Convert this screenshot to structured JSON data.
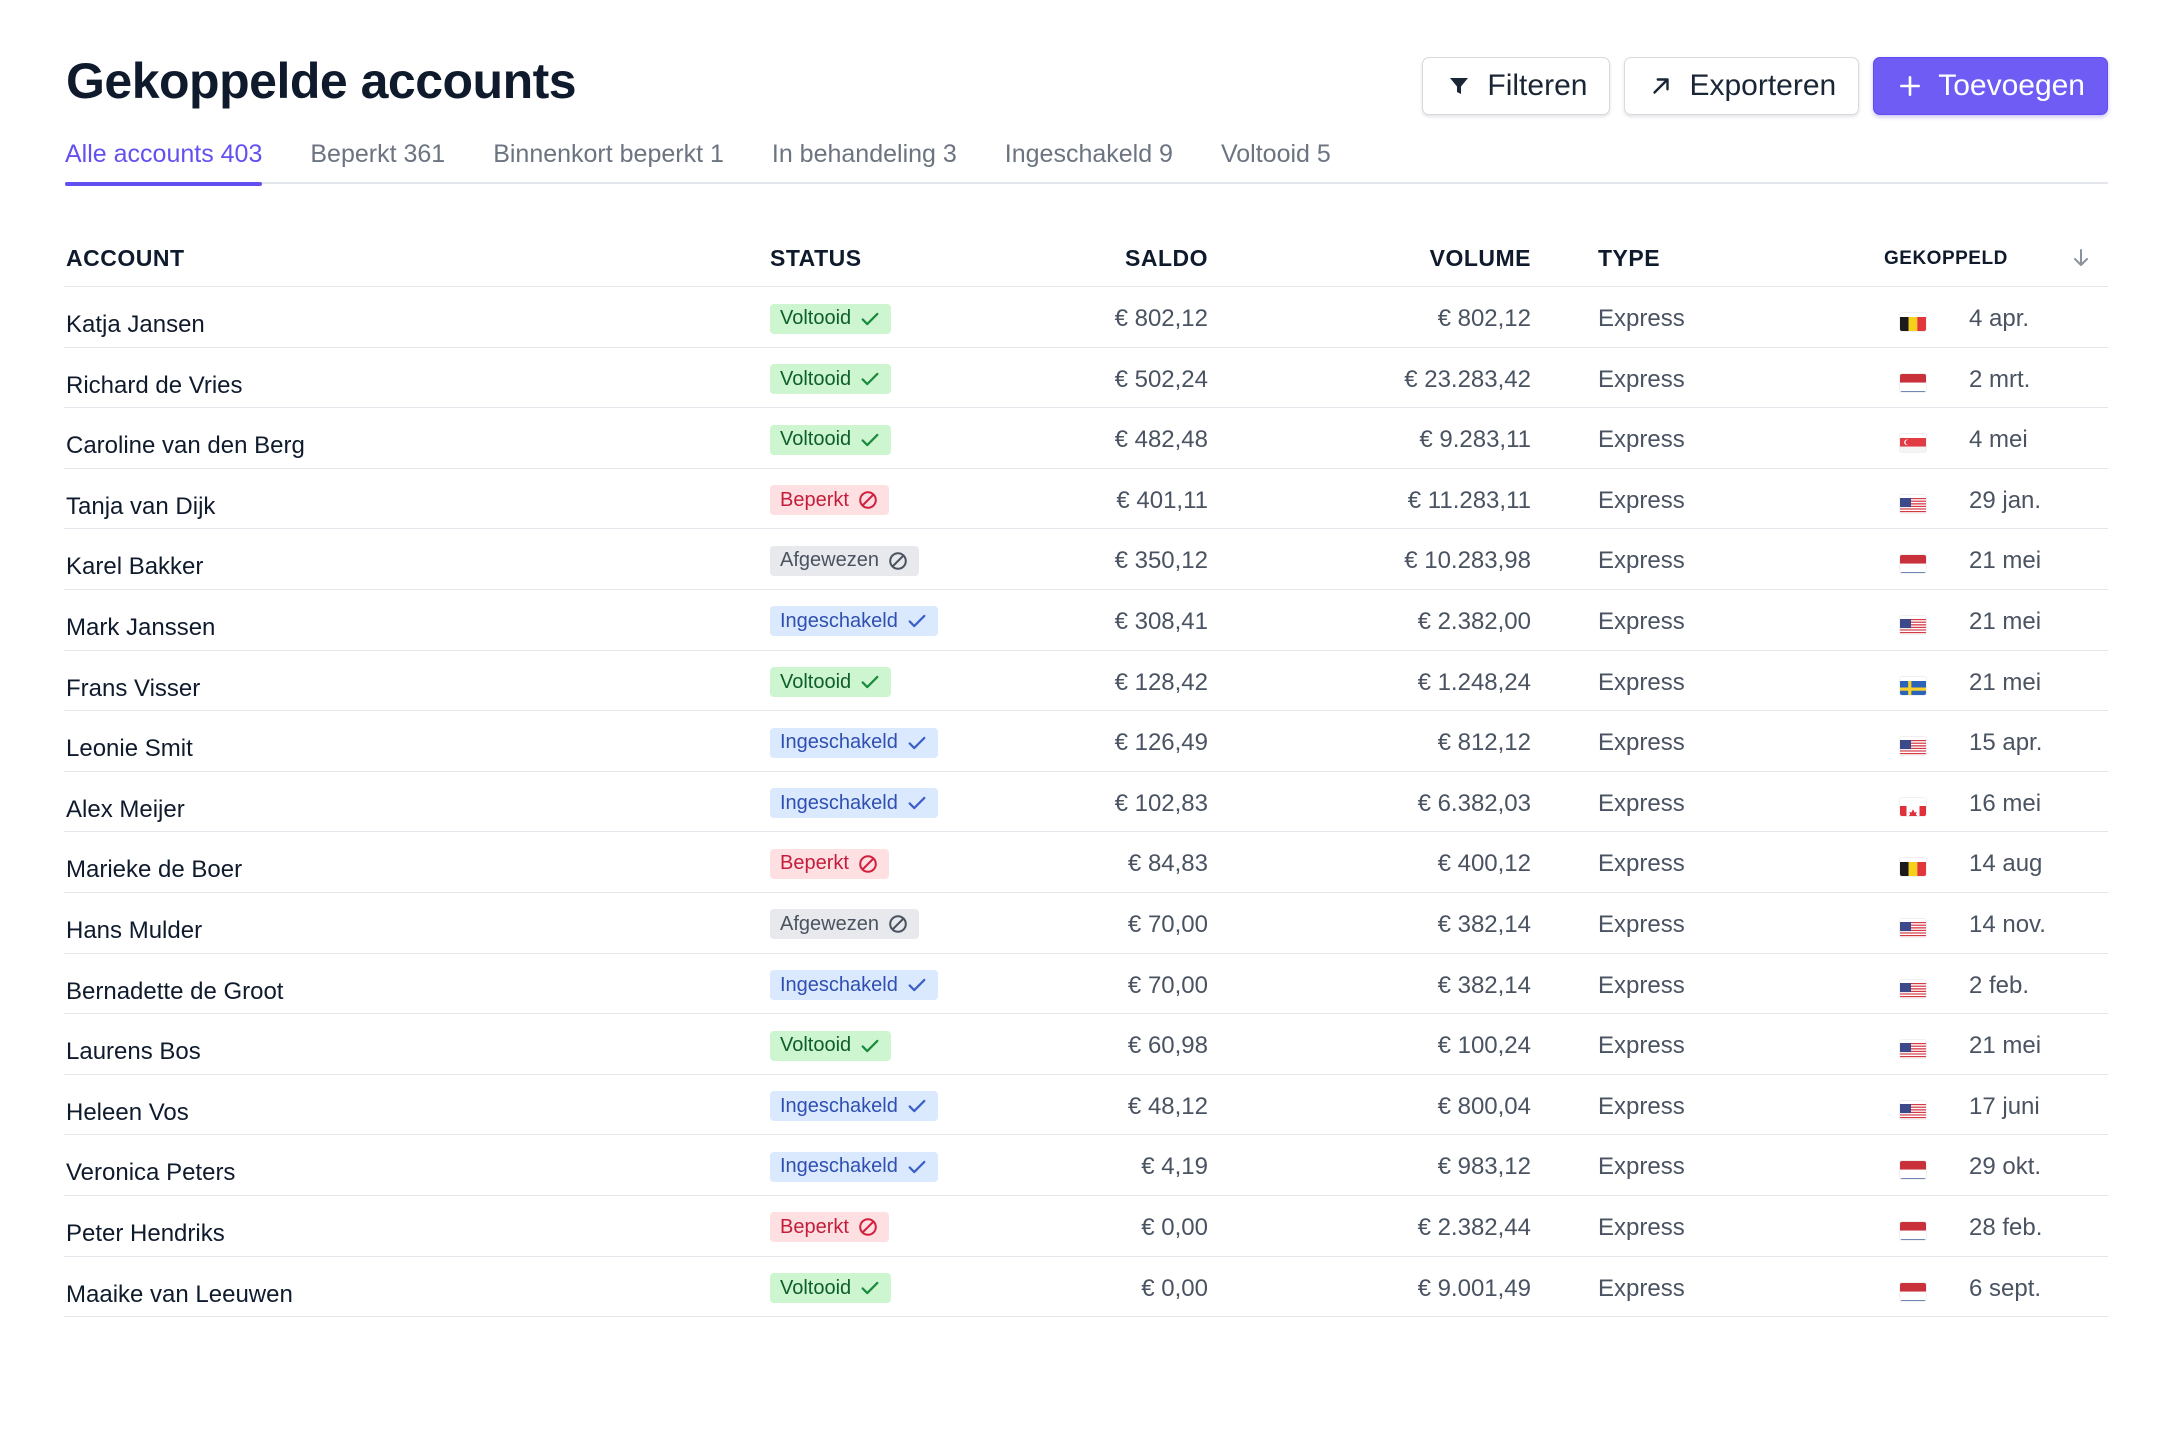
{
  "page": {
    "title": "Gekoppelde accounts"
  },
  "toolbar": {
    "filter_label": "Filteren",
    "export_label": "Exporteren",
    "add_label": "Toevoegen"
  },
  "tabs": [
    {
      "label": "Alle accounts 403",
      "active": true
    },
    {
      "label": "Beperkt 361",
      "active": false
    },
    {
      "label": "Binnenkort beperkt 1",
      "active": false
    },
    {
      "label": "In behandeling 3",
      "active": false
    },
    {
      "label": "Ingeschakeld 9",
      "active": false
    },
    {
      "label": "Voltooid 5",
      "active": false
    }
  ],
  "table": {
    "headers": {
      "account": "ACCOUNT",
      "status": "STATUS",
      "saldo": "SALDO",
      "volume": "VOLUME",
      "type": "TYPE",
      "gekoppeld": "GEKOPPELD"
    },
    "rows": [
      {
        "name": "Katja Jansen",
        "status": "Voltooid",
        "status_kind": "voltooid",
        "saldo": "€ 802,12",
        "volume": "€ 802,12",
        "type": "Express",
        "flag": "BE",
        "date": "4 apr."
      },
      {
        "name": "Richard de Vries",
        "status": "Voltooid",
        "status_kind": "voltooid",
        "saldo": "€ 502,24",
        "volume": "€ 23.283,42",
        "type": "Express",
        "flag": "NL",
        "date": "2 mrt."
      },
      {
        "name": "Caroline van den Berg",
        "status": "Voltooid",
        "status_kind": "voltooid",
        "saldo": "€ 482,48",
        "volume": "€ 9.283,11",
        "type": "Express",
        "flag": "SG",
        "date": "4 mei"
      },
      {
        "name": "Tanja van Dijk",
        "status": "Beperkt",
        "status_kind": "beperkt",
        "saldo": "€ 401,11",
        "volume": "€ 11.283,11",
        "type": "Express",
        "flag": "US",
        "date": "29 jan."
      },
      {
        "name": "Karel Bakker",
        "status": "Afgewezen",
        "status_kind": "afgewezen",
        "saldo": "€ 350,12",
        "volume": "€ 10.283,98",
        "type": "Express",
        "flag": "NL",
        "date": "21 mei"
      },
      {
        "name": "Mark Janssen",
        "status": "Ingeschakeld",
        "status_kind": "ingeschakeld",
        "saldo": "€ 308,41",
        "volume": "€ 2.382,00",
        "type": "Express",
        "flag": "US",
        "date": "21 mei"
      },
      {
        "name": "Frans Visser",
        "status": "Voltooid",
        "status_kind": "voltooid",
        "saldo": "€ 128,42",
        "volume": "€ 1.248,24",
        "type": "Express",
        "flag": "SE",
        "date": "21 mei"
      },
      {
        "name": "Leonie Smit",
        "status": "Ingeschakeld",
        "status_kind": "ingeschakeld",
        "saldo": "€ 126,49",
        "volume": "€ 812,12",
        "type": "Express",
        "flag": "US",
        "date": "15 apr."
      },
      {
        "name": "Alex Meijer",
        "status": "Ingeschakeld",
        "status_kind": "ingeschakeld",
        "saldo": "€ 102,83",
        "volume": "€ 6.382,03",
        "type": "Express",
        "flag": "CA",
        "date": "16 mei"
      },
      {
        "name": "Marieke de Boer",
        "status": "Beperkt",
        "status_kind": "beperkt",
        "saldo": "€ 84,83",
        "volume": "€ 400,12",
        "type": "Express",
        "flag": "BE",
        "date": "14 aug"
      },
      {
        "name": "Hans Mulder",
        "status": "Afgewezen",
        "status_kind": "afgewezen",
        "saldo": "€ 70,00",
        "volume": "€ 382,14",
        "type": "Express",
        "flag": "US",
        "date": "14 nov."
      },
      {
        "name": "Bernadette de Groot",
        "status": "Ingeschakeld",
        "status_kind": "ingeschakeld",
        "saldo": "€ 70,00",
        "volume": "€ 382,14",
        "type": "Express",
        "flag": "US",
        "date": "2 feb."
      },
      {
        "name": "Laurens Bos",
        "status": "Voltooid",
        "status_kind": "voltooid",
        "saldo": "€ 60,98",
        "volume": "€ 100,24",
        "type": "Express",
        "flag": "US",
        "date": "21 mei"
      },
      {
        "name": "Heleen Vos",
        "status": "Ingeschakeld",
        "status_kind": "ingeschakeld",
        "saldo": "€ 48,12",
        "volume": "€ 800,04",
        "type": "Express",
        "flag": "US",
        "date": "17 juni"
      },
      {
        "name": "Veronica Peters",
        "status": "Ingeschakeld",
        "status_kind": "ingeschakeld",
        "saldo": "€ 4,19",
        "volume": "€ 983,12",
        "type": "Express",
        "flag": "NL",
        "date": "29 okt."
      },
      {
        "name": "Peter Hendriks",
        "status": "Beperkt",
        "status_kind": "beperkt",
        "saldo": "€ 0,00",
        "volume": "€ 2.382,44",
        "type": "Express",
        "flag": "NL",
        "date": "28 feb."
      },
      {
        "name": "Maaike van Leeuwen",
        "status": "Voltooid",
        "status_kind": "voltooid",
        "saldo": "€ 0,00",
        "volume": "€ 9.001,49",
        "type": "Express",
        "flag": "NL",
        "date": "6 sept."
      }
    ]
  },
  "colors": {
    "accent": "#6e5cf5",
    "voltooid_bg": "#cdf5cf",
    "beperkt_bg": "#ffe0e2",
    "afgewezen_bg": "#e7e9ec",
    "ingeschakeld_bg": "#dbe9ff"
  },
  "icons": {
    "filter": "filter-icon",
    "export": "arrow-up-right-icon",
    "add": "plus-icon",
    "sort": "arrow-down-icon",
    "voltooid": "check-icon",
    "beperkt": "ban-icon",
    "afgewezen": "ban-icon",
    "ingeschakeld": "check-icon"
  }
}
